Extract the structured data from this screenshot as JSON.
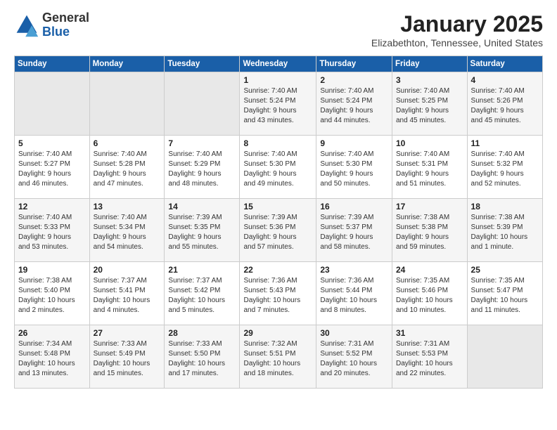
{
  "header": {
    "logo_general": "General",
    "logo_blue": "Blue",
    "month": "January 2025",
    "location": "Elizabethton, Tennessee, United States"
  },
  "weekdays": [
    "Sunday",
    "Monday",
    "Tuesday",
    "Wednesday",
    "Thursday",
    "Friday",
    "Saturday"
  ],
  "weeks": [
    [
      {
        "day": "",
        "info": ""
      },
      {
        "day": "",
        "info": ""
      },
      {
        "day": "",
        "info": ""
      },
      {
        "day": "1",
        "info": "Sunrise: 7:40 AM\nSunset: 5:24 PM\nDaylight: 9 hours\nand 43 minutes."
      },
      {
        "day": "2",
        "info": "Sunrise: 7:40 AM\nSunset: 5:24 PM\nDaylight: 9 hours\nand 44 minutes."
      },
      {
        "day": "3",
        "info": "Sunrise: 7:40 AM\nSunset: 5:25 PM\nDaylight: 9 hours\nand 45 minutes."
      },
      {
        "day": "4",
        "info": "Sunrise: 7:40 AM\nSunset: 5:26 PM\nDaylight: 9 hours\nand 45 minutes."
      }
    ],
    [
      {
        "day": "5",
        "info": "Sunrise: 7:40 AM\nSunset: 5:27 PM\nDaylight: 9 hours\nand 46 minutes."
      },
      {
        "day": "6",
        "info": "Sunrise: 7:40 AM\nSunset: 5:28 PM\nDaylight: 9 hours\nand 47 minutes."
      },
      {
        "day": "7",
        "info": "Sunrise: 7:40 AM\nSunset: 5:29 PM\nDaylight: 9 hours\nand 48 minutes."
      },
      {
        "day": "8",
        "info": "Sunrise: 7:40 AM\nSunset: 5:30 PM\nDaylight: 9 hours\nand 49 minutes."
      },
      {
        "day": "9",
        "info": "Sunrise: 7:40 AM\nSunset: 5:30 PM\nDaylight: 9 hours\nand 50 minutes."
      },
      {
        "day": "10",
        "info": "Sunrise: 7:40 AM\nSunset: 5:31 PM\nDaylight: 9 hours\nand 51 minutes."
      },
      {
        "day": "11",
        "info": "Sunrise: 7:40 AM\nSunset: 5:32 PM\nDaylight: 9 hours\nand 52 minutes."
      }
    ],
    [
      {
        "day": "12",
        "info": "Sunrise: 7:40 AM\nSunset: 5:33 PM\nDaylight: 9 hours\nand 53 minutes."
      },
      {
        "day": "13",
        "info": "Sunrise: 7:40 AM\nSunset: 5:34 PM\nDaylight: 9 hours\nand 54 minutes."
      },
      {
        "day": "14",
        "info": "Sunrise: 7:39 AM\nSunset: 5:35 PM\nDaylight: 9 hours\nand 55 minutes."
      },
      {
        "day": "15",
        "info": "Sunrise: 7:39 AM\nSunset: 5:36 PM\nDaylight: 9 hours\nand 57 minutes."
      },
      {
        "day": "16",
        "info": "Sunrise: 7:39 AM\nSunset: 5:37 PM\nDaylight: 9 hours\nand 58 minutes."
      },
      {
        "day": "17",
        "info": "Sunrise: 7:38 AM\nSunset: 5:38 PM\nDaylight: 9 hours\nand 59 minutes."
      },
      {
        "day": "18",
        "info": "Sunrise: 7:38 AM\nSunset: 5:39 PM\nDaylight: 10 hours\nand 1 minute."
      }
    ],
    [
      {
        "day": "19",
        "info": "Sunrise: 7:38 AM\nSunset: 5:40 PM\nDaylight: 10 hours\nand 2 minutes."
      },
      {
        "day": "20",
        "info": "Sunrise: 7:37 AM\nSunset: 5:41 PM\nDaylight: 10 hours\nand 4 minutes."
      },
      {
        "day": "21",
        "info": "Sunrise: 7:37 AM\nSunset: 5:42 PM\nDaylight: 10 hours\nand 5 minutes."
      },
      {
        "day": "22",
        "info": "Sunrise: 7:36 AM\nSunset: 5:43 PM\nDaylight: 10 hours\nand 7 minutes."
      },
      {
        "day": "23",
        "info": "Sunrise: 7:36 AM\nSunset: 5:44 PM\nDaylight: 10 hours\nand 8 minutes."
      },
      {
        "day": "24",
        "info": "Sunrise: 7:35 AM\nSunset: 5:46 PM\nDaylight: 10 hours\nand 10 minutes."
      },
      {
        "day": "25",
        "info": "Sunrise: 7:35 AM\nSunset: 5:47 PM\nDaylight: 10 hours\nand 11 minutes."
      }
    ],
    [
      {
        "day": "26",
        "info": "Sunrise: 7:34 AM\nSunset: 5:48 PM\nDaylight: 10 hours\nand 13 minutes."
      },
      {
        "day": "27",
        "info": "Sunrise: 7:33 AM\nSunset: 5:49 PM\nDaylight: 10 hours\nand 15 minutes."
      },
      {
        "day": "28",
        "info": "Sunrise: 7:33 AM\nSunset: 5:50 PM\nDaylight: 10 hours\nand 17 minutes."
      },
      {
        "day": "29",
        "info": "Sunrise: 7:32 AM\nSunset: 5:51 PM\nDaylight: 10 hours\nand 18 minutes."
      },
      {
        "day": "30",
        "info": "Sunrise: 7:31 AM\nSunset: 5:52 PM\nDaylight: 10 hours\nand 20 minutes."
      },
      {
        "day": "31",
        "info": "Sunrise: 7:31 AM\nSunset: 5:53 PM\nDaylight: 10 hours\nand 22 minutes."
      },
      {
        "day": "",
        "info": ""
      }
    ]
  ],
  "colors": {
    "header_bg": "#1a5fa8",
    "logo_blue": "#1a5fa8"
  }
}
